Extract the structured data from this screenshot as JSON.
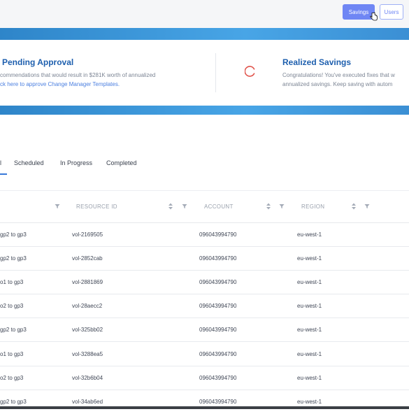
{
  "header": {
    "savings_button": "Savings",
    "users_button": "Users"
  },
  "cards": {
    "pending": {
      "title": "Pending Approval",
      "line1": "commendations that would result in $281K worth of annualized",
      "line2_link": "ck here to approve Change Manager Templates."
    },
    "realized": {
      "title": "Realized Savings",
      "line1": "Congratulations! You've executed fixes that w",
      "line2": "annualized savings. Keep saving with autom"
    }
  },
  "tabs": [
    {
      "label": "l"
    },
    {
      "label": "Scheduled"
    },
    {
      "label": "In Progress"
    },
    {
      "label": "Completed"
    }
  ],
  "table": {
    "columns": [
      "RESOURCE ID",
      "ACCOUNT",
      "REGION"
    ],
    "rows": [
      {
        "action": "gp2 to gp3",
        "resource": "vol-2169505",
        "account": "096043994790",
        "region": "eu-west-1"
      },
      {
        "action": "gp2 to gp3",
        "resource": "vol-2852cab",
        "account": "096043994790",
        "region": "eu-west-1"
      },
      {
        "action": "o1 to gp3",
        "resource": "vol-2881869",
        "account": "096043994790",
        "region": "eu-west-1"
      },
      {
        "action": "o2 to gp3",
        "resource": "vol-28aecc2",
        "account": "096043994790",
        "region": "eu-west-1"
      },
      {
        "action": "gp2 to gp3",
        "resource": "vol-325bb02",
        "account": "096043994790",
        "region": "eu-west-1"
      },
      {
        "action": "o1 to gp3",
        "resource": "vol-3288ea5",
        "account": "096043994790",
        "region": "eu-west-1"
      },
      {
        "action": "o2 to gp3",
        "resource": "vol-32b6b04",
        "account": "096043994790",
        "region": "eu-west-1"
      },
      {
        "action": "gp2 to gp3",
        "resource": "vol-34ab6ed",
        "account": "096043994790",
        "region": "eu-west-1"
      }
    ]
  },
  "colors": {
    "accent": "#6f86f4",
    "title_blue": "#1e5fae",
    "link_blue": "#4b7fe0",
    "spinner_red": "#e0524a",
    "band_blue": "#3b8fd4"
  }
}
